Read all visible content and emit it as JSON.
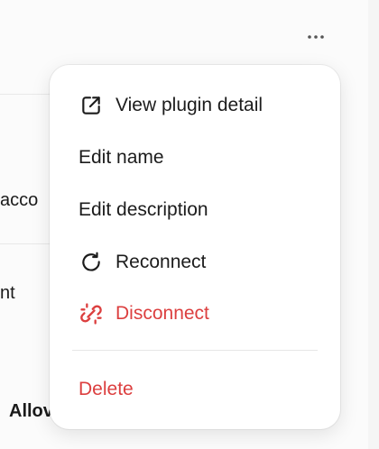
{
  "background": {
    "fragments": [
      "acco",
      "nt",
      "Allov"
    ]
  },
  "toolbar": {
    "more_icon": "ellipsis-icon"
  },
  "menu": {
    "items": [
      {
        "label": "View plugin detail",
        "icon": "external-link-icon"
      },
      {
        "label": "Edit name"
      },
      {
        "label": "Edit description"
      },
      {
        "label": "Reconnect",
        "icon": "refresh-icon"
      },
      {
        "label": "Disconnect",
        "icon": "broken-link-icon"
      },
      {
        "label": "Delete"
      }
    ]
  },
  "colors": {
    "danger": "#dc3f3f",
    "text": "#1c1c1c"
  }
}
